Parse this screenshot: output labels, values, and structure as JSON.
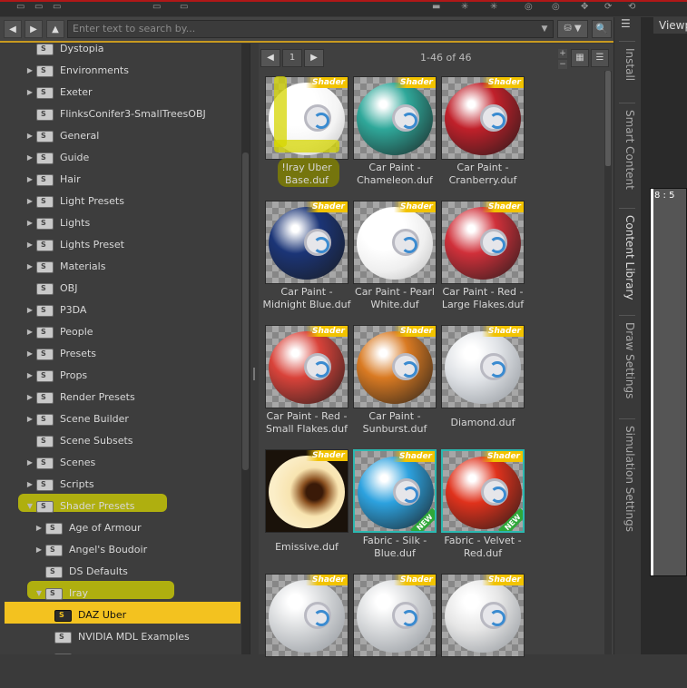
{
  "toolbar": {
    "search_placeholder": "Enter text to search by..."
  },
  "pager": {
    "page": "1",
    "count": "1-46 of 46"
  },
  "tree": [
    {
      "label": "Dystopia",
      "arrow": "",
      "y": 0
    },
    {
      "label": "Environments",
      "arrow": "▶"
    },
    {
      "label": "Exeter",
      "arrow": "▶"
    },
    {
      "label": "FlinksConifer3-SmallTreesOBJ",
      "arrow": ""
    },
    {
      "label": "General",
      "arrow": "▶"
    },
    {
      "label": "Guide",
      "arrow": "▶"
    },
    {
      "label": "Hair",
      "arrow": "▶"
    },
    {
      "label": "Light Presets",
      "arrow": "▶"
    },
    {
      "label": "Lights",
      "arrow": "▶"
    },
    {
      "label": "Lights Preset",
      "arrow": "▶"
    },
    {
      "label": "Materials",
      "arrow": "▶"
    },
    {
      "label": "OBJ",
      "arrow": ""
    },
    {
      "label": "P3DA",
      "arrow": "▶"
    },
    {
      "label": "People",
      "arrow": "▶"
    },
    {
      "label": "Presets",
      "arrow": "▶"
    },
    {
      "label": "Props",
      "arrow": "▶"
    },
    {
      "label": "Render Presets",
      "arrow": "▶"
    },
    {
      "label": "Scene Builder",
      "arrow": "▶"
    },
    {
      "label": "Scene Subsets",
      "arrow": ""
    },
    {
      "label": "Scenes",
      "arrow": "▶"
    },
    {
      "label": "Scripts",
      "arrow": "▶"
    },
    {
      "label": "Shader Presets",
      "arrow": "▼"
    },
    {
      "label": "Age of Armour",
      "arrow": "▶"
    },
    {
      "label": "Angel's Boudoir",
      "arrow": "▶"
    },
    {
      "label": "DS Defaults",
      "arrow": ""
    },
    {
      "label": "Iray",
      "arrow": "▼"
    },
    {
      "label": "DAZ Uber",
      "arrow": ""
    },
    {
      "label": "NVIDIA MDL Examples",
      "arrow": ""
    },
    {
      "label": "...",
      "arrow": ""
    }
  ],
  "tiles": [
    {
      "line1": "!Iray Uber",
      "line2": "Base.duf",
      "color": "#f4f4f4",
      "style": "white"
    },
    {
      "line1": "Car Paint -",
      "line2": "Chameleon.duf",
      "color": "#2fa89a",
      "style": "glitter"
    },
    {
      "line1": "Car Paint -",
      "line2": "Cranberry.duf",
      "color": "#c0202a",
      "style": "glitter"
    },
    {
      "line1": "Car Paint -",
      "line2": "Midnight Blue.duf",
      "color": "#1b3577",
      "style": "glitter"
    },
    {
      "line1": "Car Paint - Pearl",
      "line2": "White.duf",
      "color": "#efefef",
      "style": "white"
    },
    {
      "line1": "Car Paint - Red -",
      "line2": "Large Flakes.duf",
      "color": "#d0303a",
      "style": "glitter"
    },
    {
      "line1": "Car Paint - Red -",
      "line2": "Small Flakes.duf",
      "color": "#d9433a",
      "style": "glitter"
    },
    {
      "line1": "Car Paint -",
      "line2": "Sunburst.duf",
      "color": "#d97a22",
      "style": "glitter"
    },
    {
      "line1": "Diamond.duf",
      "line2": "",
      "color": "#dfe2e6",
      "style": "clear"
    },
    {
      "line1": "Emissive.duf",
      "line2": "",
      "color": "#f7e2a8",
      "style": "emissive"
    },
    {
      "line1": "Fabric - Silk -",
      "line2": "Blue.duf",
      "color": "#2da2df",
      "style": "new"
    },
    {
      "line1": "Fabric - Velvet -",
      "line2": "Red.duf",
      "color": "#e0321c",
      "style": "new"
    },
    {
      "line1": "",
      "line2": "",
      "color": "#d8dadc",
      "style": "clear"
    },
    {
      "line1": "",
      "line2": "",
      "color": "#d8dadc",
      "style": "clear"
    },
    {
      "line1": "",
      "line2": "",
      "color": "#e6e6e6",
      "style": "clear"
    }
  ],
  "shader_label": "Shader",
  "new_label": "NEW",
  "sidetabs": [
    "Install",
    "Smart Content",
    "Content Library",
    "Draw Settings",
    "Simulation Settings"
  ],
  "viewport": {
    "tab": "Viewp",
    "ratio": "8 : 5"
  },
  "nav": {
    "back": "◀",
    "forward": "▶",
    "up": "▲",
    "search_drop": "▼",
    "find": "🔍",
    "db": "⛁ ▼"
  }
}
